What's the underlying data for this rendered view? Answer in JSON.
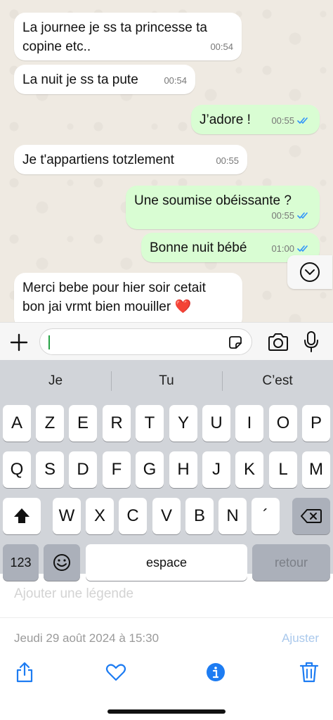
{
  "messages": [
    {
      "direction": "in",
      "text": "La journee je ss ta princesse ta\ncopine etc..",
      "time": "00:54"
    },
    {
      "direction": "in",
      "text": "La nuit je ss ta pute",
      "time": "00:54"
    },
    {
      "direction": "out",
      "text": "J’adore !",
      "time": "00:55",
      "read": true
    },
    {
      "direction": "in",
      "text": "Je t'appartiens totzlement",
      "time": "00:55"
    },
    {
      "direction": "out",
      "text": "Une soumise obéissante ?",
      "time": "00:55",
      "read": true
    },
    {
      "direction": "out",
      "text": "Bonne nuit bébé",
      "time": "01:00",
      "read": true
    },
    {
      "direction": "in",
      "text": "Merci bebe pour hier soir cetait\nbon jai vrmt bien mouiller ❤️",
      "time": ""
    }
  ],
  "composer": {
    "value": ""
  },
  "keyboard": {
    "suggestions": [
      "Je",
      "Tu",
      "C’est"
    ],
    "row1": [
      "A",
      "Z",
      "E",
      "R",
      "T",
      "Y",
      "U",
      "I",
      "O",
      "P"
    ],
    "row2": [
      "Q",
      "S",
      "D",
      "F",
      "G",
      "H",
      "J",
      "K",
      "L",
      "M"
    ],
    "row3": [
      "W",
      "X",
      "C",
      "V",
      "B",
      "N",
      "´"
    ],
    "numbers_label": "123",
    "space_label": "espace",
    "return_label": "retour"
  },
  "viewer": {
    "caption_placeholder": "Ajouter une légende",
    "date": "Jeudi 29 août 2024 à 15:30",
    "adjust_label": "Ajuster"
  },
  "colors": {
    "outgoing": "#d9fdd3",
    "incoming": "#ffffff",
    "accent": "#1d7cf2",
    "read_ticks": "#3497f9"
  }
}
